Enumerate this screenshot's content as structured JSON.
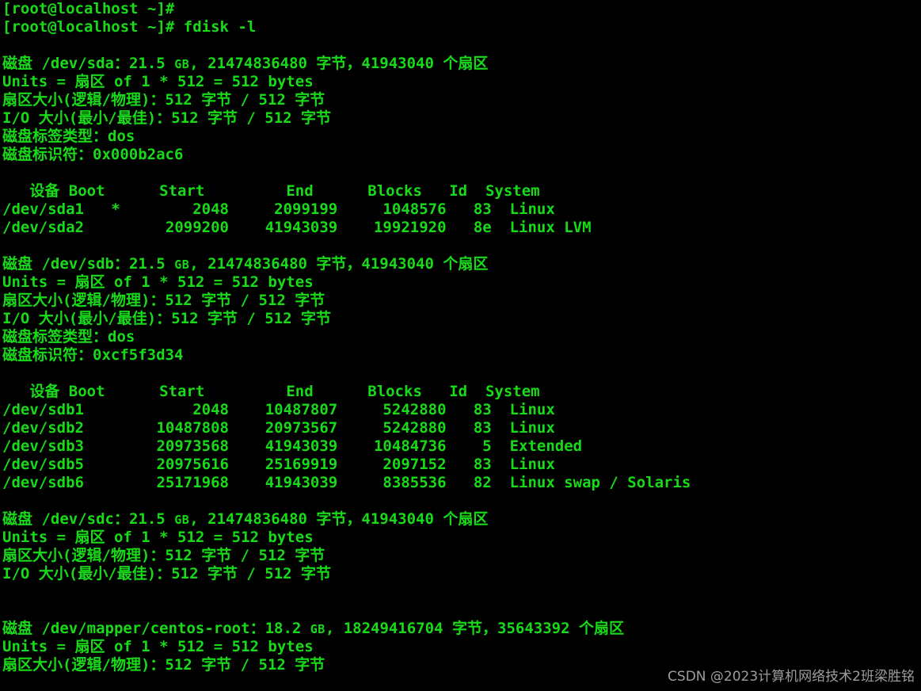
{
  "terminal": {
    "colors": {
      "background": "#000000",
      "foreground": "#18da18",
      "watermark": "#b9b9b9"
    },
    "prompt": "[root@localhost ~]#",
    "command": "fdisk -l",
    "lines": [
      "[root@localhost ~]#",
      "[root@localhost ~]# fdisk -l",
      "",
      "磁盘 /dev/sda：21.5 GB, 21474836480 字节，41943040 个扇区",
      "Units = 扇区 of 1 * 512 = 512 bytes",
      "扇区大小(逻辑/物理)：512 字节 / 512 字节",
      "I/O 大小(最小/最佳)：512 字节 / 512 字节",
      "磁盘标签类型：dos",
      "磁盘标识符：0x000b2ac6",
      "",
      "   设备 Boot      Start         End      Blocks   Id  System",
      "/dev/sda1   *        2048     2099199     1048576   83  Linux",
      "/dev/sda2         2099200    41943039    19921920   8e  Linux LVM",
      "",
      "磁盘 /dev/sdb：21.5 GB, 21474836480 字节，41943040 个扇区",
      "Units = 扇区 of 1 * 512 = 512 bytes",
      "扇区大小(逻辑/物理)：512 字节 / 512 字节",
      "I/O 大小(最小/最佳)：512 字节 / 512 字节",
      "磁盘标签类型：dos",
      "磁盘标识符：0xcf5f3d34",
      "",
      "   设备 Boot      Start         End      Blocks   Id  System",
      "/dev/sdb1            2048    10487807     5242880   83  Linux",
      "/dev/sdb2        10487808    20973567     5242880   83  Linux",
      "/dev/sdb3        20973568    41943039    10484736    5  Extended",
      "/dev/sdb5        20975616    25169919     2097152   83  Linux",
      "/dev/sdb6        25171968    41943039     8385536   82  Linux swap / Solaris",
      "",
      "磁盘 /dev/sdc：21.5 GB, 21474836480 字节，41943040 个扇区",
      "Units = 扇区 of 1 * 512 = 512 bytes",
      "扇区大小(逻辑/物理)：512 字节 / 512 字节",
      "I/O 大小(最小/最佳)：512 字节 / 512 字节",
      "",
      "",
      "磁盘 /dev/mapper/centos-root：18.2 GB, 18249416704 字节，35643392 个扇区",
      "Units = 扇区 of 1 * 512 = 512 bytes",
      "扇区大小(逻辑/物理)：512 字节 / 512 字节"
    ],
    "disks": [
      {
        "device": "/dev/sda",
        "size_human": "21.5 GB",
        "size_bytes": "21474836480",
        "sectors": "41943040",
        "units": "Units = 扇区 of 1 * 512 = 512 bytes",
        "sector_size": "扇区大小(逻辑/物理)：512 字节 / 512 字节",
        "io_size": "I/O 大小(最小/最佳)：512 字节 / 512 字节",
        "label_type": "dos",
        "identifier": "0x000b2ac6",
        "table_headers": [
          "设备",
          "Boot",
          "Start",
          "End",
          "Blocks",
          "Id",
          "System"
        ],
        "partitions": [
          {
            "device": "/dev/sda1",
            "boot": "*",
            "start": "2048",
            "end": "2099199",
            "blocks": "1048576",
            "id": "83",
            "system": "Linux"
          },
          {
            "device": "/dev/sda2",
            "boot": "",
            "start": "2099200",
            "end": "41943039",
            "blocks": "19921920",
            "id": "8e",
            "system": "Linux LVM"
          }
        ]
      },
      {
        "device": "/dev/sdb",
        "size_human": "21.5 GB",
        "size_bytes": "21474836480",
        "sectors": "41943040",
        "units": "Units = 扇区 of 1 * 512 = 512 bytes",
        "sector_size": "扇区大小(逻辑/物理)：512 字节 / 512 字节",
        "io_size": "I/O 大小(最小/最佳)：512 字节 / 512 字节",
        "label_type": "dos",
        "identifier": "0xcf5f3d34",
        "table_headers": [
          "设备",
          "Boot",
          "Start",
          "End",
          "Blocks",
          "Id",
          "System"
        ],
        "partitions": [
          {
            "device": "/dev/sdb1",
            "boot": "",
            "start": "2048",
            "end": "10487807",
            "blocks": "5242880",
            "id": "83",
            "system": "Linux"
          },
          {
            "device": "/dev/sdb2",
            "boot": "",
            "start": "10487808",
            "end": "20973567",
            "blocks": "5242880",
            "id": "83",
            "system": "Linux"
          },
          {
            "device": "/dev/sdb3",
            "boot": "",
            "start": "20973568",
            "end": "41943039",
            "blocks": "10484736",
            "id": "5",
            "system": "Extended"
          },
          {
            "device": "/dev/sdb5",
            "boot": "",
            "start": "20975616",
            "end": "25169919",
            "blocks": "2097152",
            "id": "83",
            "system": "Linux"
          },
          {
            "device": "/dev/sdb6",
            "boot": "",
            "start": "25171968",
            "end": "41943039",
            "blocks": "8385536",
            "id": "82",
            "system": "Linux swap / Solaris"
          }
        ]
      },
      {
        "device": "/dev/sdc",
        "size_human": "21.5 GB",
        "size_bytes": "21474836480",
        "sectors": "41943040",
        "units": "Units = 扇区 of 1 * 512 = 512 bytes",
        "sector_size": "扇区大小(逻辑/物理)：512 字节 / 512 字节",
        "io_size": "I/O 大小(最小/最佳)：512 字节 / 512 字节",
        "label_type": "",
        "identifier": "",
        "table_headers": [],
        "partitions": []
      },
      {
        "device": "/dev/mapper/centos-root",
        "size_human": "18.2 GB",
        "size_bytes": "18249416704",
        "sectors": "35643392",
        "units": "Units = 扇区 of 1 * 512 = 512 bytes",
        "sector_size": "扇区大小(逻辑/物理)：512 字节 / 512 字节",
        "label_type": "",
        "identifier": "",
        "table_headers": [],
        "partitions": []
      }
    ]
  },
  "watermark": {
    "text": "CSDN @2023计算机网络技术2班梁胜铭"
  }
}
